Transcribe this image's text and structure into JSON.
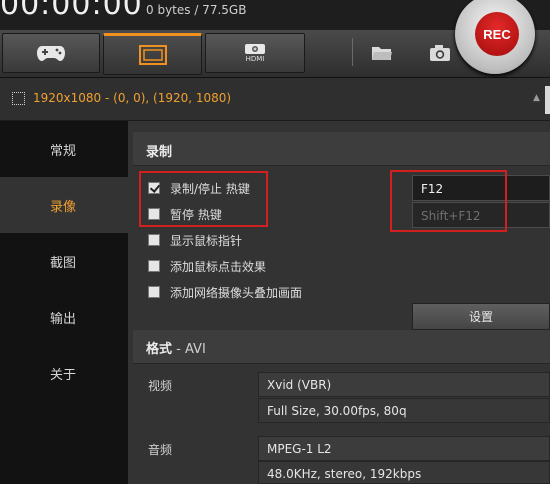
{
  "topbar": {
    "timer": "00:00:00",
    "size": "0 bytes / 77.5GB"
  },
  "rec_button": {
    "label": "REC"
  },
  "modes": [
    {
      "name": "game-mode",
      "icon": "gamepad-icon"
    },
    {
      "name": "screen-mode",
      "icon": "screen-rectangle-icon",
      "active": true
    },
    {
      "name": "hdmi-mode",
      "icon": "hdmi-device-icon",
      "label": "HDMI"
    }
  ],
  "toolbar": {
    "folder_icon": "folder-icon",
    "camera_icon": "camera-icon"
  },
  "area": {
    "text": "1920x1080 - (0, 0), (1920, 1080)"
  },
  "sidebar": {
    "items": [
      {
        "label": "常规"
      },
      {
        "label": "录像",
        "active": true
      },
      {
        "label": "截图"
      },
      {
        "label": "输出"
      },
      {
        "label": "关于"
      }
    ]
  },
  "record": {
    "title": "录制",
    "options": [
      {
        "label": "录制/停止 热键",
        "checked": true
      },
      {
        "label": "暂停 热键",
        "checked": false
      },
      {
        "label": "显示鼠标指针",
        "checked": false
      },
      {
        "label": "添加鼠标点击效果",
        "checked": false
      },
      {
        "label": "添加网络摄像头叠加画面",
        "checked": false
      }
    ],
    "hotkey_record": "F12",
    "hotkey_pause": "Shift+F12",
    "settings_button": "设置"
  },
  "format": {
    "title": "格式",
    "separator": " - ",
    "container": "AVI",
    "video_label": "视频",
    "video_codec": "Xvid (VBR)",
    "video_params": "Full Size, 30.00fps, 80q",
    "audio_label": "音频",
    "audio_codec": "MPEG-1 L2",
    "audio_params": "48.0KHz, stereo, 192kbps"
  }
}
